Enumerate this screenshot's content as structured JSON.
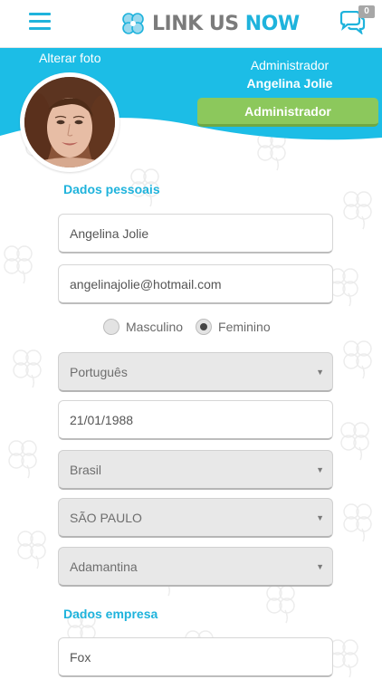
{
  "header": {
    "menu_icon": "hamburger-menu-icon",
    "logo_part1": "LINK US ",
    "logo_part2": "NOW",
    "chat_icon": "chat-bubbles-icon",
    "chat_badge": "0",
    "accent_color": "#1fb3dc"
  },
  "profile": {
    "change_photo": "Alterar foto",
    "role_label": "Administrador",
    "user_name": "Angelina Jolie",
    "role_button": "Administrador",
    "role_button_color": "#8cc85c"
  },
  "personal": {
    "section_title": "Dados pessoais",
    "name": "Angelina Jolie",
    "email": "angelinajolie@hotmail.com",
    "gender_male": "Masculino",
    "gender_female": "Feminino",
    "gender_selected": "Feminino",
    "language": "Português",
    "birthdate": "21/01/1988",
    "country": "Brasil",
    "state": "SÃO PAULO",
    "city": "Adamantina"
  },
  "company": {
    "section_title": "Dados empresa",
    "name": "Fox"
  }
}
